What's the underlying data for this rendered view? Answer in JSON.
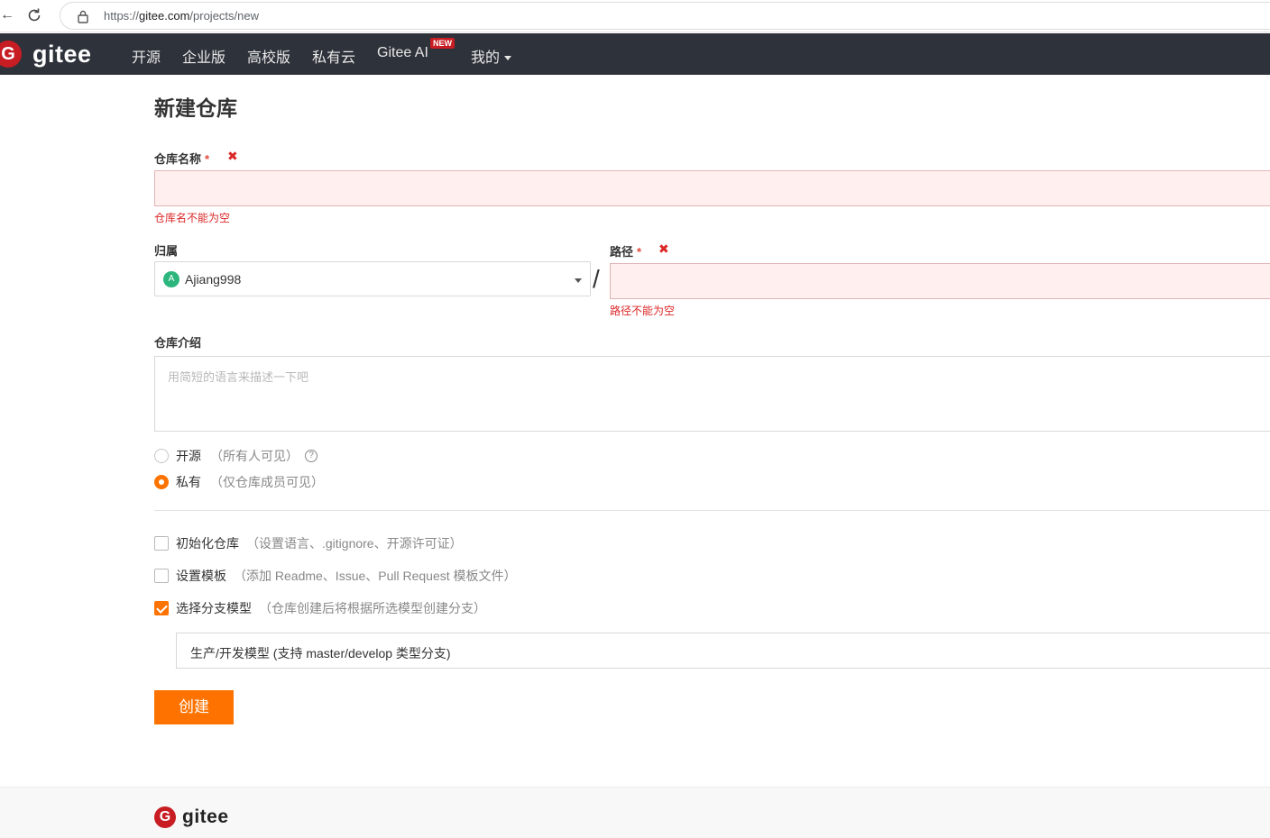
{
  "browser": {
    "url_prefix": "https://",
    "url_host": "gitee.com",
    "url_path": "/projects/new"
  },
  "navbar": {
    "logo_text": "gitee",
    "items": [
      "开源",
      "企业版",
      "高校版",
      "私有云",
      "Gitee AI"
    ],
    "new_badge": "NEW",
    "my_label": "我的"
  },
  "form": {
    "title": "新建仓库",
    "repo_name": {
      "label": "仓库名称",
      "required_mark": "*",
      "value": "",
      "error": "仓库名不能为空"
    },
    "owner": {
      "label": "归属",
      "avatar_letter": "A",
      "value": "Ajiang998"
    },
    "path_separator": "/",
    "path": {
      "label": "路径",
      "required_mark": "*",
      "value": "",
      "error": "路径不能为空"
    },
    "description": {
      "label": "仓库介绍",
      "placeholder": "用简短的语言来描述一下吧"
    },
    "visibility": [
      {
        "label": "开源",
        "hint": "（所有人可见）",
        "selected": false
      },
      {
        "label": "私有",
        "hint": "（仅仓库成员可见）",
        "selected": true
      }
    ],
    "options": [
      {
        "label": "初始化仓库",
        "hint": "（设置语言、.gitignore、开源许可证）",
        "checked": false
      },
      {
        "label": "设置模板",
        "hint": "（添加 Readme、Issue、Pull Request 模板文件）",
        "checked": false
      },
      {
        "label": "选择分支模型",
        "hint": "（仓库创建后将根据所选模型创建分支）",
        "checked": true
      }
    ],
    "branch_model_value": "生产/开发模型 (支持 master/develop 类型分支)",
    "submit_label": "创建"
  },
  "footer": {
    "logo_text": "gitee"
  },
  "colors": {
    "brand": "#c71d23",
    "accent": "#fe7300",
    "navbar_bg": "#2e323a",
    "error": "#db2828"
  }
}
